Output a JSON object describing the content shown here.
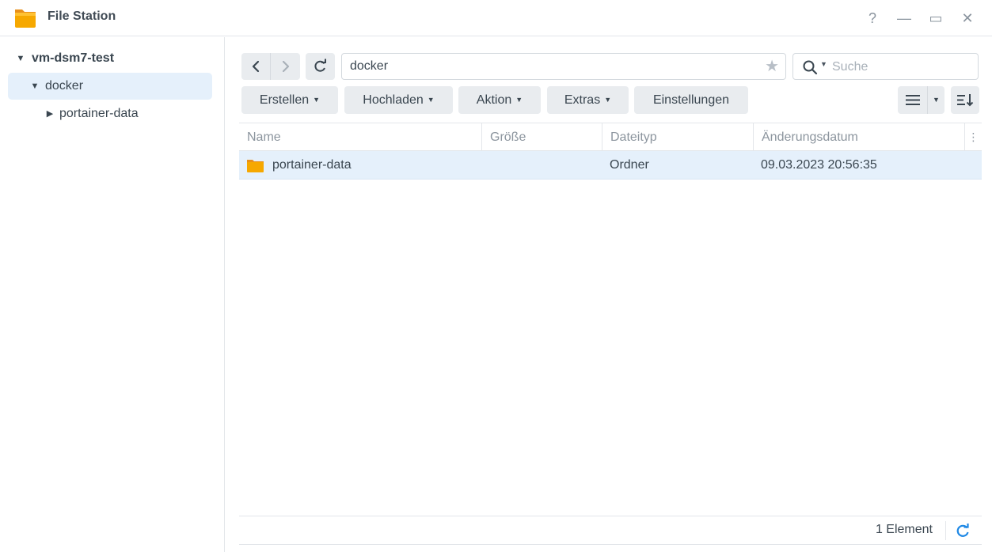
{
  "window": {
    "title": "File Station",
    "help_glyph": "?",
    "minimize_glyph": "—",
    "maximize_glyph": "▭",
    "close_glyph": "✕"
  },
  "sidebar": {
    "root": {
      "label": "vm-dsm7-test",
      "expanded": true
    },
    "items": [
      {
        "label": "docker",
        "expanded": true,
        "selected": true
      },
      {
        "label": "portainer-data",
        "expanded": false,
        "selected": false
      }
    ]
  },
  "toolbar": {
    "path": "docker",
    "search_placeholder": "Suche",
    "buttons": {
      "create": "Erstellen",
      "upload": "Hochladen",
      "action": "Aktion",
      "extras": "Extras",
      "settings": "Einstellungen"
    }
  },
  "table": {
    "columns": [
      "Name",
      "Größe",
      "Dateityp",
      "Änderungsdatum"
    ],
    "rows": [
      {
        "name": "portainer-data",
        "size": "",
        "type": "Ordner",
        "modified": "09.03.2023 20:56:35",
        "selected": true
      }
    ]
  },
  "status": {
    "count_text": "1 Element"
  },
  "colors": {
    "accent": "#1e88e5",
    "selection": "#e5f0fb",
    "folder": "#f6a800",
    "button_bg": "#e9ecef"
  },
  "icons": [
    "app-folder-icon",
    "help-icon",
    "minimize-icon",
    "maximize-icon",
    "close-icon",
    "back-icon",
    "forward-icon",
    "refresh-icon",
    "star-icon",
    "search-icon",
    "list-view-icon",
    "sort-icon",
    "folder-icon",
    "column-menu-icon"
  ]
}
